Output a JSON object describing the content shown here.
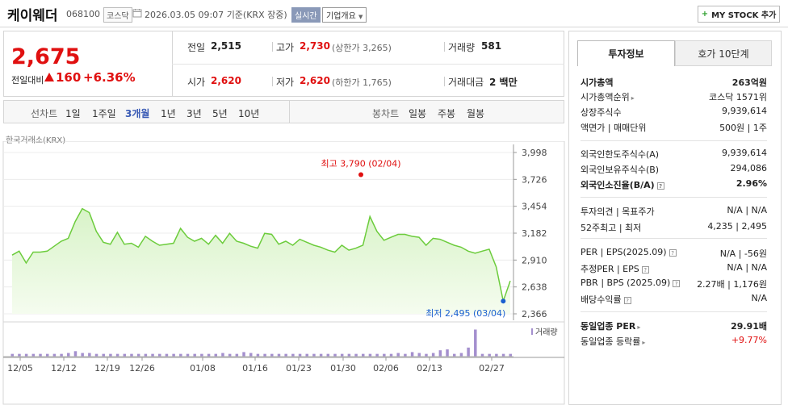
{
  "header": {
    "name": "케이웨더",
    "code": "068100",
    "market": "코스닥",
    "datetime": "2026.03.05 09:07",
    "basis": "기준(KRX 장중)",
    "live_badge": "실시간",
    "company_info": "기업개요",
    "mystock_label": "MY STOCK 추가"
  },
  "price": {
    "current": "2,675",
    "change_label": "전일대비",
    "change": "160",
    "change_pct": "+6.36%"
  },
  "summary": {
    "prev_label": "전일",
    "prev": "2,515",
    "high_label": "고가",
    "high": "2,730",
    "upper_limit": "(상한가 3,265)",
    "volume_label": "거래량",
    "volume": "581",
    "open_label": "시가",
    "open": "2,620",
    "low_label": "저가",
    "low": "2,620",
    "lower_limit": "(하한가 1,765)",
    "amount_label": "거래대금",
    "amount": "2 백만"
  },
  "periods": {
    "line_title": "선차트",
    "line_items": [
      "1일",
      "1주일",
      "3개월",
      "1년",
      "3년",
      "5년",
      "10년"
    ],
    "active": "3개월",
    "candle_title": "봉차트",
    "candle_items": [
      "일봉",
      "주봉",
      "월봉"
    ]
  },
  "chart_data": {
    "type": "area",
    "source_label": "한국거래소(KRX)",
    "y_ticks": [
      3998,
      3726,
      3454,
      3182,
      2910,
      2638,
      2366
    ],
    "y_tick_labels": [
      "3,998",
      "3,726",
      "3,454",
      "3,182",
      "2,910",
      "2,638",
      "2,366"
    ],
    "ylim": [
      2366,
      3998
    ],
    "x_tick_labels": [
      "12/05",
      "12/12",
      "12/19",
      "12/26",
      "01/08",
      "01/16",
      "01/23",
      "01/30",
      "02/06",
      "02/13",
      "02/27"
    ],
    "high_annotation": "최고 3,790 (02/04)",
    "low_annotation": "최저 2,495 (03/04)",
    "volume_label": "거래량",
    "values": [
      2960,
      3000,
      2880,
      2990,
      2990,
      3000,
      3050,
      3100,
      3130,
      3300,
      3430,
      3390,
      3200,
      3090,
      3070,
      3190,
      3070,
      3080,
      3040,
      3150,
      3100,
      3060,
      3070,
      3080,
      3230,
      3140,
      3100,
      3130,
      3070,
      3160,
      3080,
      3180,
      3100,
      3080,
      3050,
      3030,
      3180,
      3170,
      3070,
      3100,
      3060,
      3120,
      3090,
      3060,
      3040,
      3010,
      2990,
      3060,
      3010,
      3030,
      3060,
      3350,
      3200,
      3110,
      3140,
      3170,
      3170,
      3150,
      3140,
      3060,
      3130,
      3120,
      3090,
      3060,
      3040,
      3000,
      2980,
      3000,
      3020,
      2840,
      2495,
      2700
    ],
    "volumes": [
      3,
      3,
      3,
      3,
      3,
      3,
      3,
      3,
      4,
      6,
      4,
      4,
      3,
      3,
      3,
      3,
      3,
      3,
      3,
      3,
      3,
      3,
      3,
      3,
      3,
      3,
      3,
      3,
      3,
      3,
      4,
      3,
      3,
      5,
      4,
      3,
      3,
      3,
      3,
      3,
      3,
      3,
      3,
      3,
      3,
      3,
      3,
      3,
      3,
      3,
      3,
      3,
      3,
      3,
      3,
      4,
      3,
      5,
      4,
      3,
      4,
      7,
      8,
      3,
      4,
      10,
      30,
      3,
      3,
      3,
      3,
      3
    ]
  },
  "invest": {
    "tab_info": "투자정보",
    "tab_quote": "호가 10단계",
    "mcap_label": "시가총액",
    "mcap": "263억원",
    "mcap_rank_label": "시가총액순위",
    "mcap_rank": "코스닥 1571위",
    "shares_label": "상장주식수",
    "shares": "9,939,614",
    "par_label": "액면가 | 매매단위",
    "par": "500원 | 1주",
    "foreign_limit_label": "외국인한도주식수(A)",
    "foreign_limit": "9,939,614",
    "foreign_hold_label": "외국인보유주식수(B)",
    "foreign_hold": "294,086",
    "foreign_ratio_label": "외국인소진율(B/A)",
    "foreign_ratio": "2.96%",
    "opinion_label": "투자의견 | 목표주가",
    "opinion": "N/A | N/A",
    "w52_label": "52주최고 | 최저",
    "w52": "4,235 | 2,495",
    "per_label": "PER | EPS(2025.09)",
    "per": "N/A | -56원",
    "est_per_label": "추정PER | EPS",
    "est_per": "N/A | N/A",
    "pbr_label": "PBR | BPS (2025.09)",
    "pbr": "2.27배 | 1,176원",
    "div_label": "배당수익률",
    "div": "N/A",
    "ind_per_label": "동일업종 PER",
    "ind_per": "29.91배",
    "ind_rate_label": "동일업종 등락률",
    "ind_rate": "+9.77%"
  }
}
